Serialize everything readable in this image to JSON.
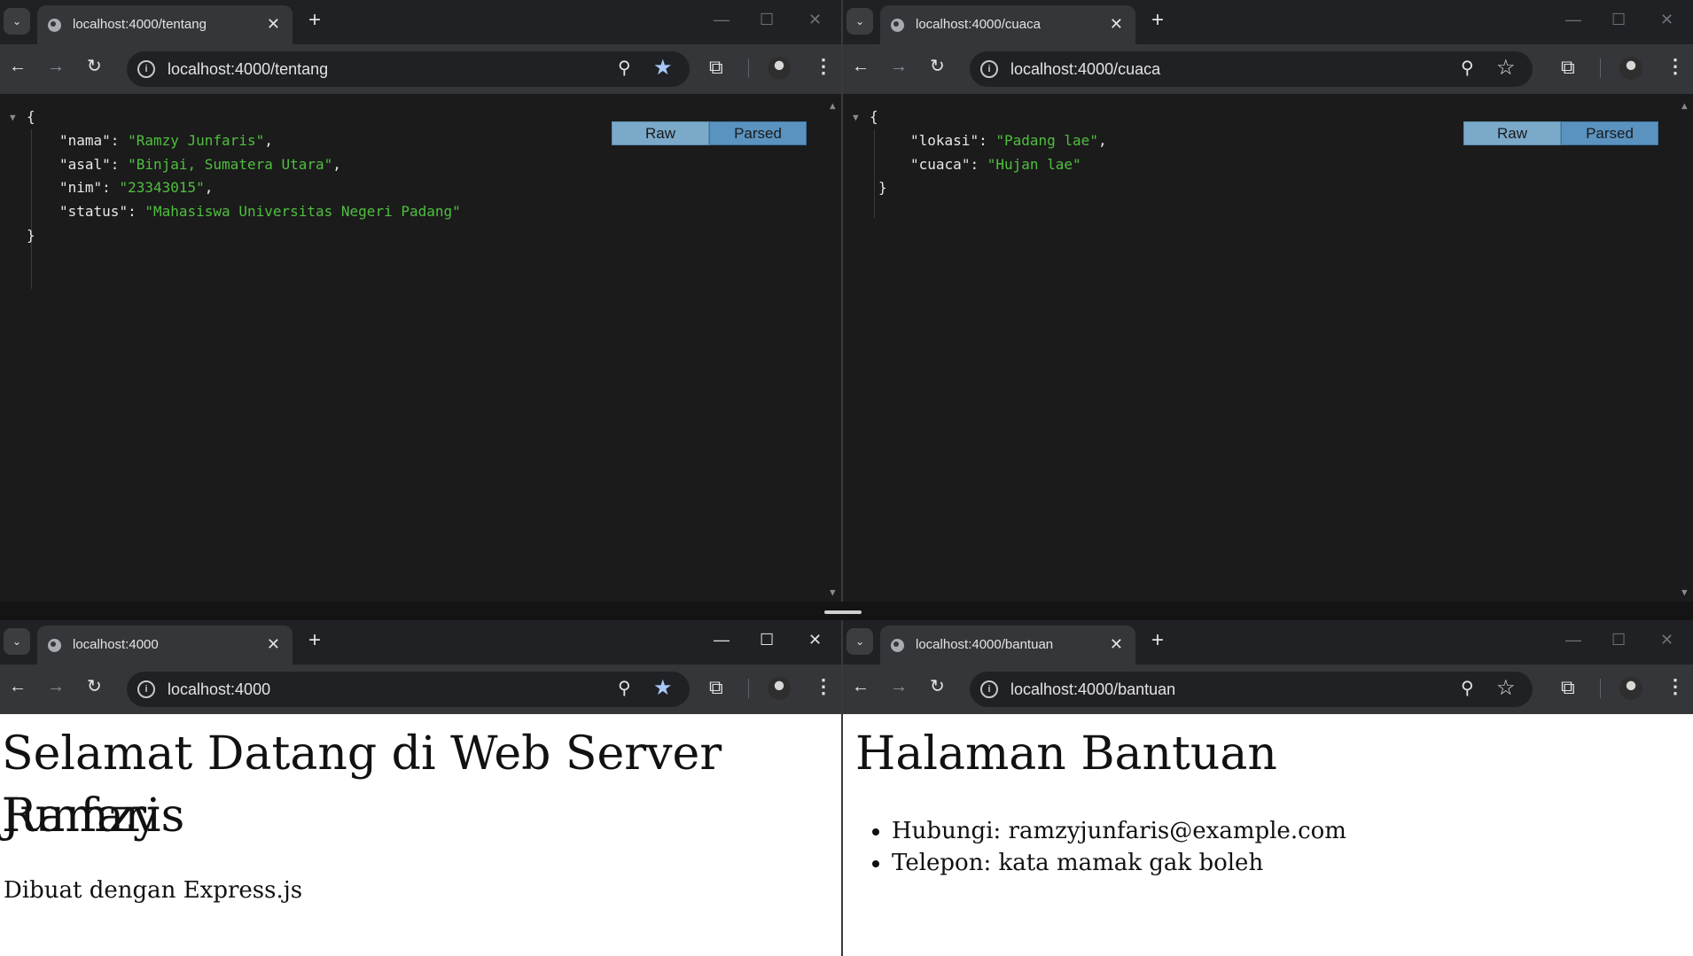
{
  "windows": {
    "tl": {
      "tab_title": "localhost:4000/tentang",
      "url": "localhost:4000/tentang",
      "json_lines": [
        {
          "key": "nama",
          "value": "Ramzy Junfaris"
        },
        {
          "key": "asal",
          "value": "Binjai, Sumatera Utara"
        },
        {
          "key": "nim",
          "value": "23343015"
        },
        {
          "key": "status",
          "value": "Mahasiswa Universitas Negeri Padang"
        }
      ]
    },
    "tr": {
      "tab_title": "localhost:4000/cuaca",
      "url": "localhost:4000/cuaca",
      "json_lines": [
        {
          "key": "lokasi",
          "value": "Padang lae"
        },
        {
          "key": "cuaca",
          "value": "Hujan lae"
        }
      ]
    },
    "bl": {
      "tab_title": "localhost:4000",
      "url": "localhost:4000",
      "heading_line1": "Selamat Datang di Web Server Ramzy",
      "heading_line2": "Junfaris",
      "paragraph": "Dibuat dengan Express.js"
    },
    "br": {
      "tab_title": "localhost:4000/bantuan",
      "url": "localhost:4000/bantuan",
      "heading": "Halaman Bantuan",
      "items": [
        "Hubungi: ramzyjunfaris@example.com",
        "Telepon: kata mamak gak boleh"
      ]
    }
  },
  "json_viewer": {
    "raw_label": "Raw",
    "parsed_label": "Parsed"
  },
  "glyphs": {
    "tab_dropdown": "⌄",
    "tab_close": "✕",
    "new_tab": "+",
    "minimize": "—",
    "maximize": "☐",
    "close": "✕",
    "back": "←",
    "forward": "→",
    "reload": "↻",
    "info": "i",
    "zoom": "⚲",
    "star": "★",
    "star_outline": "☆",
    "extensions": "⧉",
    "menu": "⋮",
    "open_brace": "{",
    "close_brace": "}",
    "collapse_caret": "▼"
  },
  "colors": {
    "json_string": "#4fbf3f",
    "raw_button": "#7ba9c9",
    "parsed_button": "#5b93c0",
    "bookmark_star": "#a8c7fa"
  }
}
